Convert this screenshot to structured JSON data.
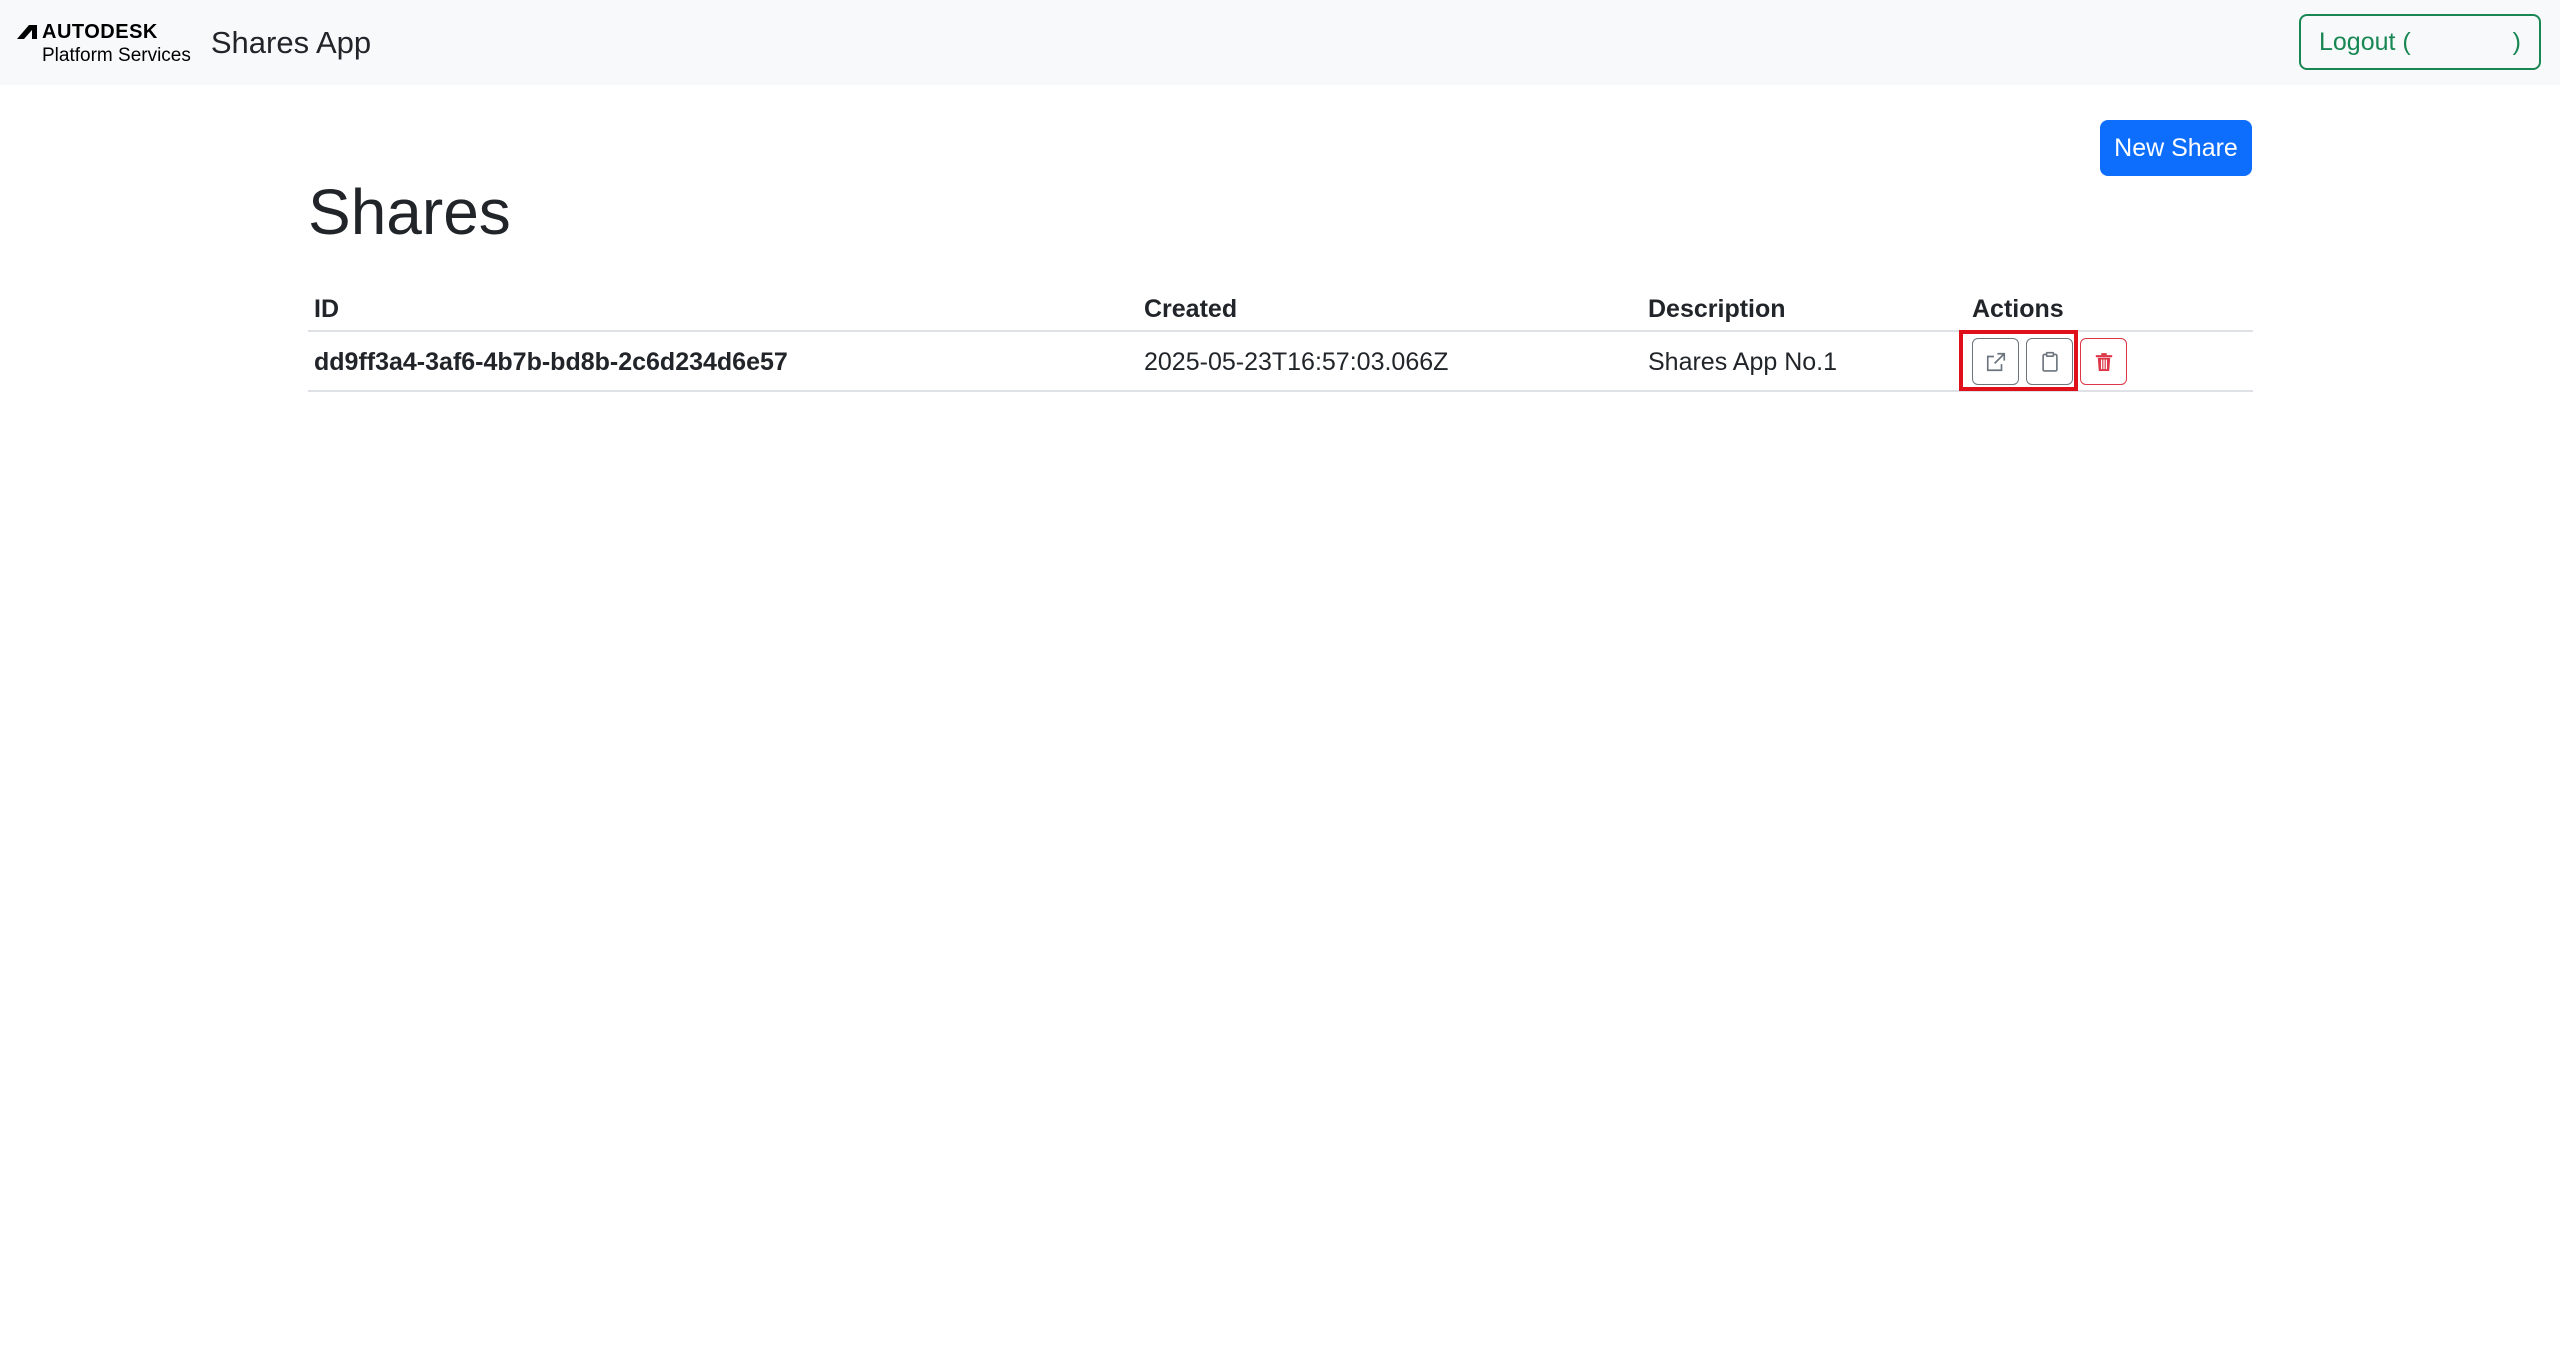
{
  "navbar": {
    "logo_word": "AUTODESK",
    "logo_sub": "Platform Services",
    "app_name": "Shares App",
    "logout_label": "Logout (",
    "logout_close": ")"
  },
  "toolbar": {
    "new_share_label": "New Share"
  },
  "page": {
    "title": "Shares"
  },
  "table": {
    "headers": {
      "id": "ID",
      "created": "Created",
      "description": "Description",
      "actions": "Actions"
    },
    "rows": [
      {
        "id": "dd9ff3a4-3af6-4b7b-bd8b-2c6d234d6e57",
        "created": "2025-05-23T16:57:03.066Z",
        "description": "Shares App No.1",
        "actions": [
          "external-link-icon",
          "clipboard-icon",
          "trash-icon"
        ]
      }
    ]
  },
  "colors": {
    "primary": "#0d6efd",
    "success": "#198754",
    "danger": "#dc3545",
    "secondary": "#6c757d",
    "highlight": "#e0101a"
  }
}
